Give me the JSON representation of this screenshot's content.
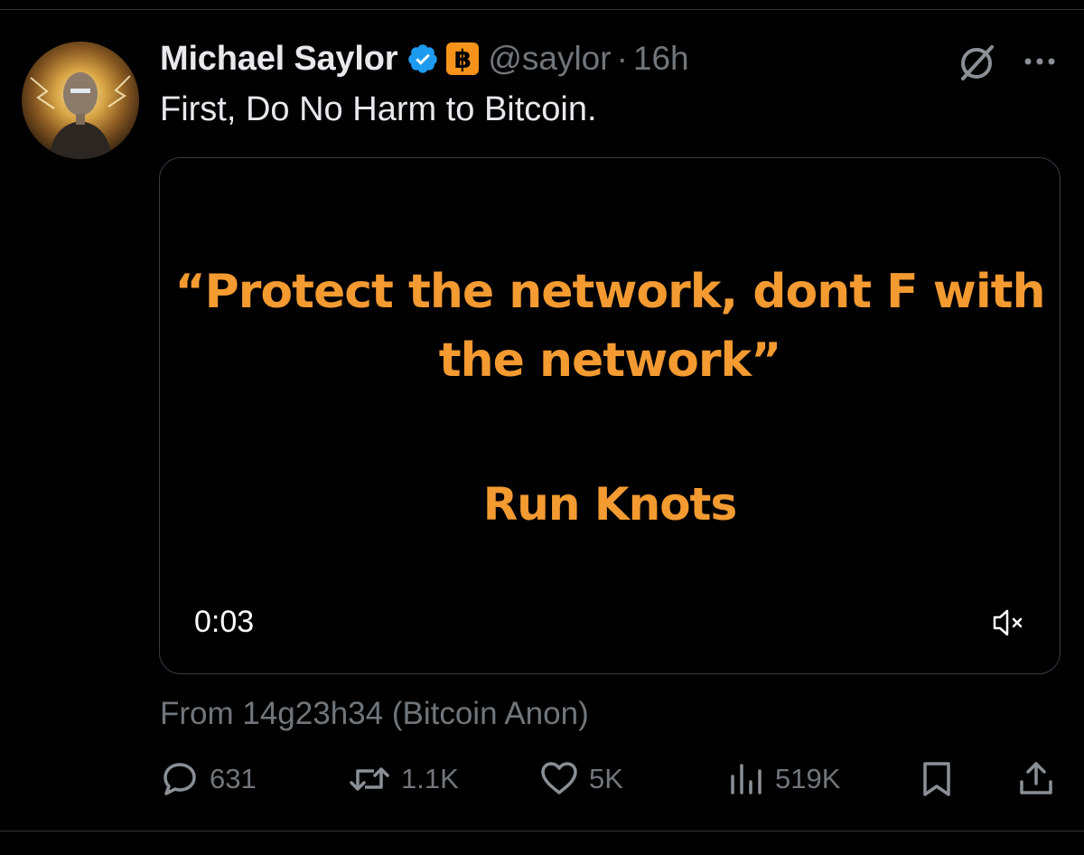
{
  "tweet": {
    "author": {
      "display_name": "Michael Saylor",
      "badge_symbol": "฿",
      "handle": "@saylor",
      "separator": "·",
      "time": "16h"
    },
    "text": "First, Do No Harm to Bitcoin.",
    "media": {
      "quote_lines": [
        "“Protect the network, dont F with",
        "the network”"
      ],
      "cta": "Run Knots",
      "duration": "0:03",
      "text_color": "#f39a31"
    },
    "attribution": "From 14g23h34 (Bitcoin Anon)",
    "stats": {
      "replies": "631",
      "reposts": "1.1K",
      "likes": "5K",
      "views": "519K"
    }
  },
  "colors": {
    "background": "#000000",
    "text": "#e7e9ea",
    "muted": "#71767b",
    "verified": "#1d9bf0",
    "bitcoin": "#f7931a"
  },
  "icons": {
    "verified": "verified-badge-icon",
    "grok": "grok-icon",
    "more": "more-icon",
    "mute": "mute-icon",
    "reply": "reply-icon",
    "repost": "repost-icon",
    "like": "like-icon",
    "views": "views-icon",
    "bookmark": "bookmark-icon",
    "share": "share-icon"
  }
}
